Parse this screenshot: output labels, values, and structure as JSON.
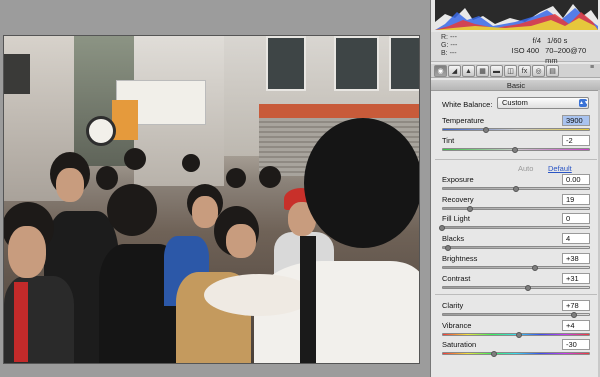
{
  "readout": {
    "r_label": "R:",
    "r_value": "---",
    "g_label": "G:",
    "g_value": "---",
    "b_label": "B:",
    "b_value": "---",
    "aperture": "f/4",
    "shutter": "1/60 s",
    "iso": "ISO 400",
    "lens": "70–200@70 mm"
  },
  "toolbar": {
    "tabs": [
      "basic-tab",
      "tone-curve-tab",
      "detail-tab",
      "hsl-tab",
      "split-toning-tab",
      "lens-corrections-tab",
      "effects-tab",
      "camera-calibration-tab",
      "presets-tab"
    ],
    "active_index": 0
  },
  "panel_title": "Basic",
  "white_balance": {
    "label": "White Balance:",
    "value": "Custom"
  },
  "auto_label": "Auto",
  "default_label": "Default",
  "controls": {
    "temperature": {
      "label": "Temperature",
      "value": "3900",
      "level": 0.3
    },
    "tint": {
      "label": "Tint",
      "value": "-2",
      "level": 0.49
    },
    "exposure": {
      "label": "Exposure",
      "value": "0.00",
      "level": 0.5
    },
    "recovery": {
      "label": "Recovery",
      "value": "19",
      "level": 0.19
    },
    "fill_light": {
      "label": "Fill Light",
      "value": "0",
      "level": 0.0
    },
    "blacks": {
      "label": "Blacks",
      "value": "4",
      "level": 0.04
    },
    "brightness": {
      "label": "Brightness",
      "value": "+38",
      "level": 0.63
    },
    "contrast": {
      "label": "Contrast",
      "value": "+31",
      "level": 0.58
    },
    "clarity": {
      "label": "Clarity",
      "value": "+78",
      "level": 0.89
    },
    "vibrance": {
      "label": "Vibrance",
      "value": "+4",
      "level": 0.52
    },
    "saturation": {
      "label": "Saturation",
      "value": "-30",
      "level": 0.35
    }
  },
  "colors": {
    "accent": "#3b73d6",
    "link": "#2a55c4",
    "panel": "#e7e7e7"
  }
}
